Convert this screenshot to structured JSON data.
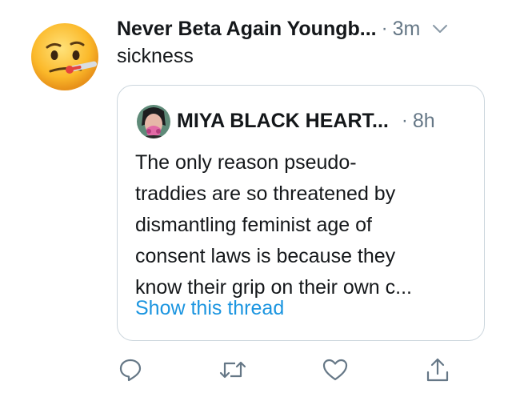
{
  "tweet": {
    "author_name": "Never Beta Again Youngb...",
    "separator": "·",
    "time": "3m",
    "text": "sickness",
    "avatar_icon": "face-with-thermometer-emoji",
    "menu_icon": "chevron-down-icon"
  },
  "quoted_tweet": {
    "author_name": "MIYA BLACK HEART...",
    "separator": "·",
    "time": "8h",
    "text_lines": [
      "The only reason pseudo-",
      "traddies are so threatened by",
      "dismantling feminist age of",
      "consent laws is because they",
      "know their grip on their own c..."
    ],
    "show_thread_label": "Show this thread"
  },
  "actions": [
    {
      "icon": "reply-icon"
    },
    {
      "icon": "retweet-icon"
    },
    {
      "icon": "like-icon"
    },
    {
      "icon": "share-icon"
    }
  ],
  "colors": {
    "text_primary": "#14171a",
    "text_secondary": "#657786",
    "link": "#1b95e0",
    "border": "#ccd6dd"
  }
}
